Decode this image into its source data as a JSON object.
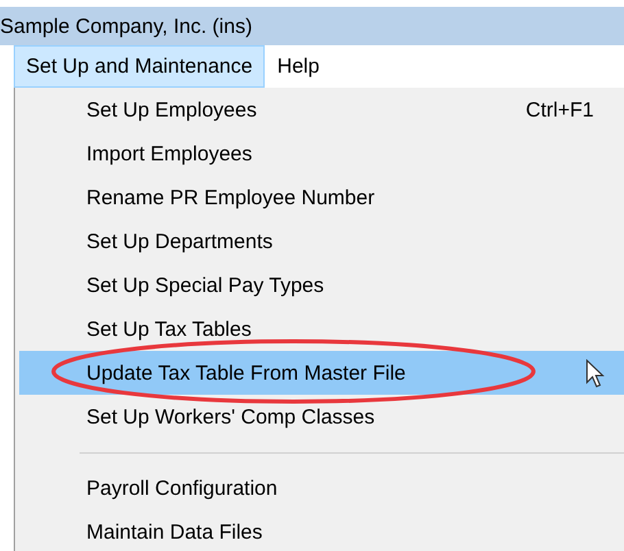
{
  "window": {
    "title": "Sample Company, Inc. (ins)"
  },
  "menubar": [
    {
      "label": "Set Up and Maintenance",
      "selected": true
    },
    {
      "label": "Help",
      "selected": false
    }
  ],
  "menu": [
    {
      "kind": "item",
      "label": "Set Up Employees",
      "shortcut": "Ctrl+F1",
      "selected": false
    },
    {
      "kind": "item",
      "label": "Import Employees",
      "selected": false
    },
    {
      "kind": "item",
      "label": "Rename PR Employee Number",
      "selected": false
    },
    {
      "kind": "item",
      "label": "Set Up Departments",
      "selected": false
    },
    {
      "kind": "item",
      "label": "Set Up Special Pay Types",
      "selected": false
    },
    {
      "kind": "item",
      "label": "Set Up Tax Tables",
      "selected": false
    },
    {
      "kind": "item",
      "label": "Update Tax Table From Master File",
      "selected": true
    },
    {
      "kind": "item",
      "label": "Set Up Workers' Comp Classes",
      "selected": false
    },
    {
      "kind": "separator"
    },
    {
      "kind": "item",
      "label": "Payroll Configuration",
      "selected": false
    },
    {
      "kind": "item",
      "label": "Maintain Data Files",
      "selected": false
    }
  ]
}
